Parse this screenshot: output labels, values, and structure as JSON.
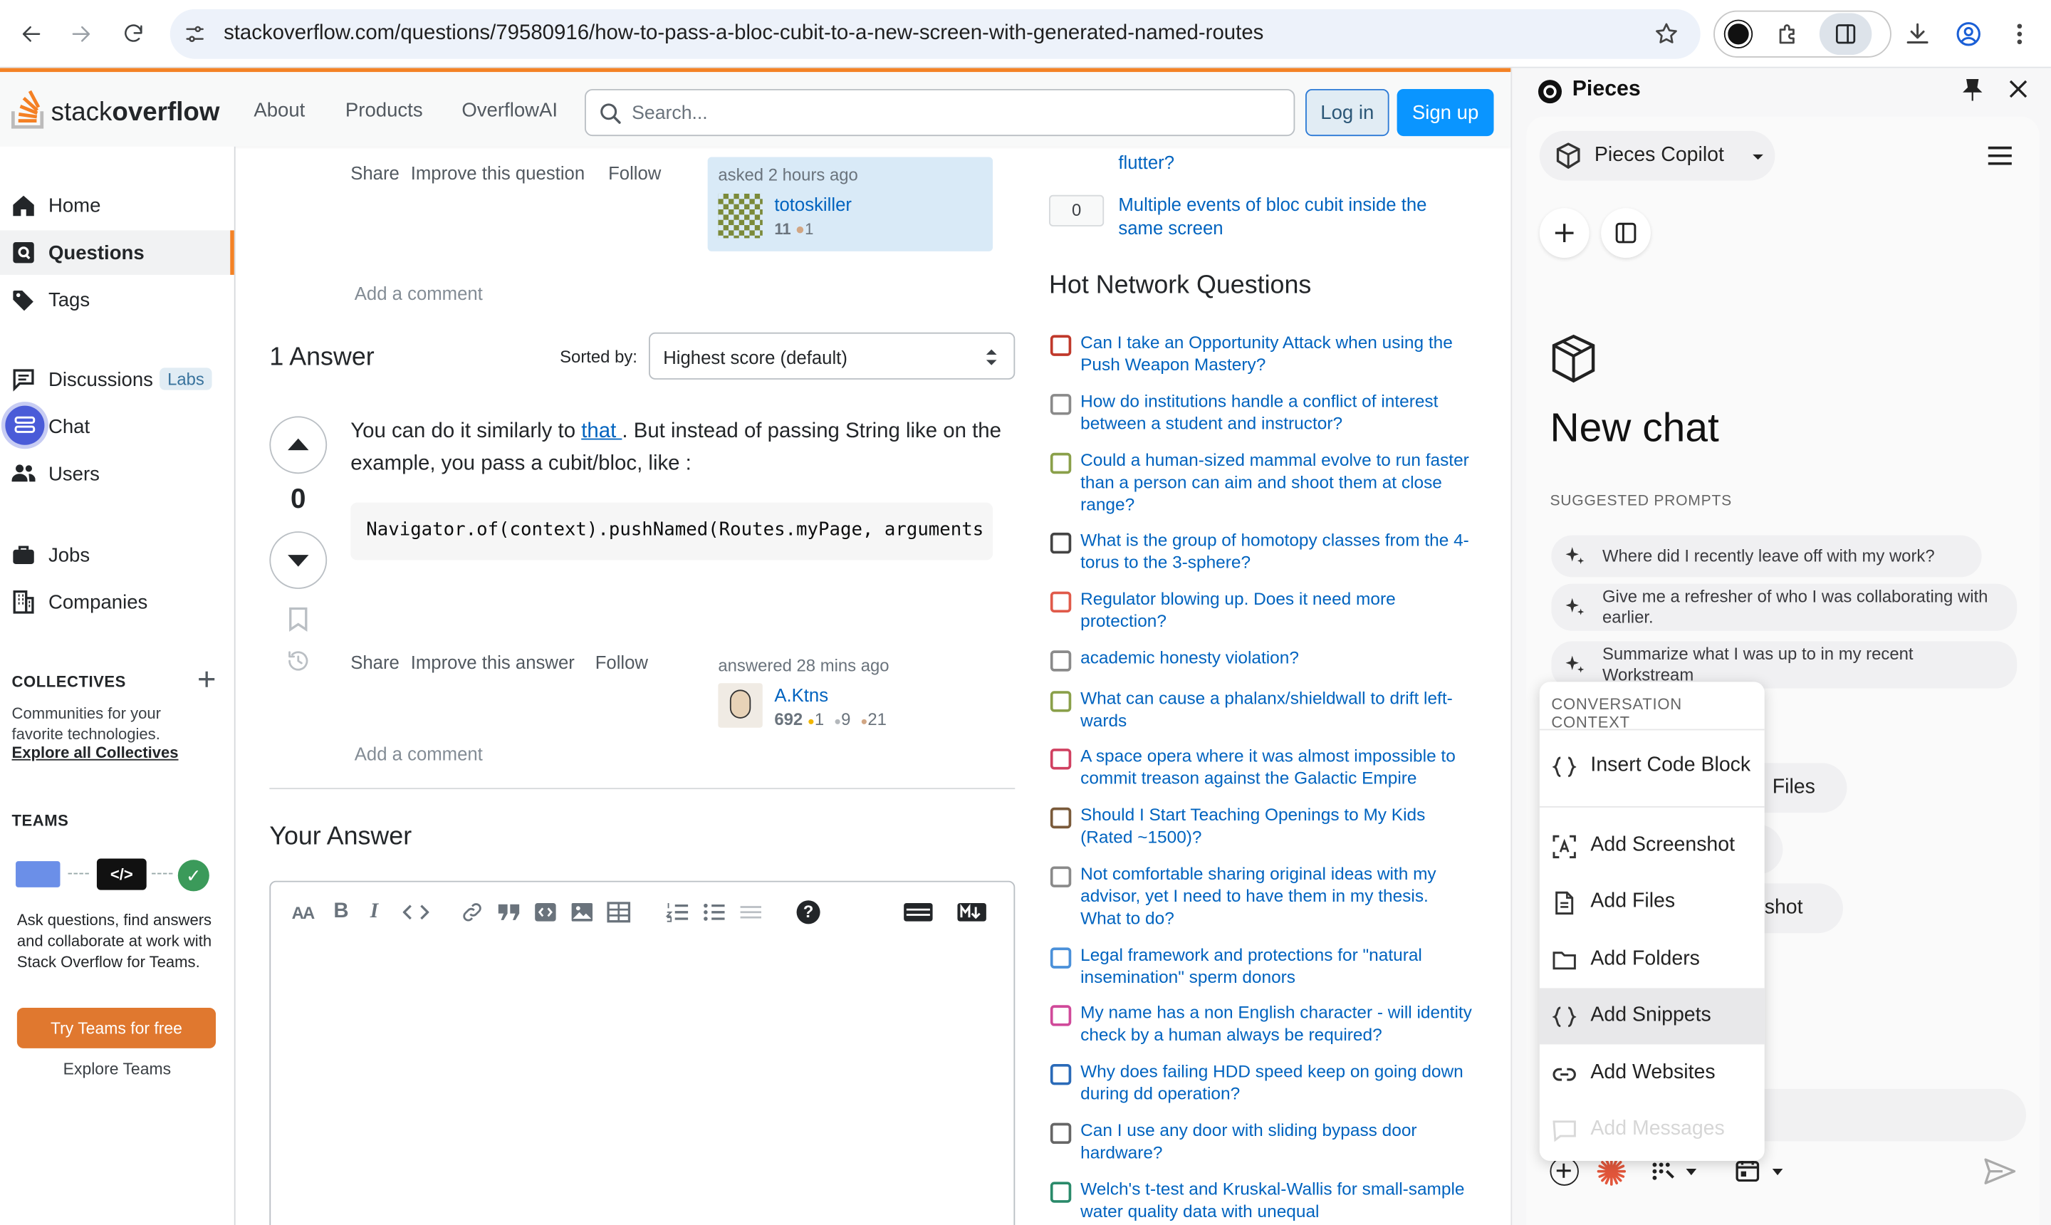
{
  "browser": {
    "url": "stackoverflow.com/questions/79580916/how-to-pass-a-bloc-cubit-to-a-new-screen-with-generated-named-routes"
  },
  "so_header": {
    "logo_text_light": "stack",
    "logo_text_bold": "overflow",
    "nav": [
      "About",
      "Products",
      "OverflowAI"
    ],
    "search_placeholder": "Search...",
    "login": "Log in",
    "signup": "Sign up"
  },
  "left_nav": {
    "items": [
      "Home",
      "Questions",
      "Tags",
      "Discussions",
      "Chat",
      "Users",
      "Jobs",
      "Companies"
    ],
    "labs_badge": "Labs",
    "collectives_title": "COLLECTIVES",
    "collectives_desc": "Communities for your favorite technologies.",
    "collectives_link": "Explore all Collectives",
    "teams_title": "TEAMS",
    "teams_desc": "Ask questions, find answers and collaborate at work with Stack Overflow for Teams.",
    "teams_button": "Try Teams for free",
    "teams_link": "Explore Teams"
  },
  "question": {
    "actions": [
      "Share",
      "Improve this question",
      "Follow"
    ],
    "asked_label": "asked 2 hours ago",
    "asker_name": "totoskiller",
    "asker_rep": "11",
    "asker_bronze": "1",
    "add_comment": "Add a comment"
  },
  "answers": {
    "count_label": "1 Answer",
    "sorted_label": "Sorted by:",
    "sort_value": "Highest score (default)",
    "vote_count": "0",
    "body_pre": "You can do it similarly to ",
    "body_link": "that ",
    "body_post": ". But instead of passing String like on the example, you pass a cubit/bloc, like :",
    "code": "Navigator.of(context).pushNamed(Routes.myPage, arguments",
    "actions": [
      "Share",
      "Improve this answer",
      "Follow"
    ],
    "answered_label": "answered 28 mins ago",
    "answerer_name": "A.Ktns",
    "answerer_rep": "692",
    "gold": "1",
    "silver": "9",
    "bronze": "21",
    "add_comment": "Add a comment",
    "your_answer": "Your Answer"
  },
  "related": {
    "partial_title": "flutter?",
    "item_score": "0",
    "item_title": "Multiple events of bloc cubit inside the same screen"
  },
  "hot_network": {
    "title": "Hot Network Questions",
    "items": [
      "Can I take an Opportunity Attack when using the Push Weapon Mastery?",
      "How do institutions handle a conflict of interest between a student and instructor?",
      "Could a human-sized mammal evolve to run faster than a person can aim and shoot them at close range?",
      "What is the group of homotopy classes from the 4-torus to the 3-sphere?",
      "Regulator blowing up. Does it need more protection?",
      "academic honesty violation?",
      "What can cause a phalanx/shieldwall to drift left-wards",
      "A space opera where it was almost impossible to commit treason against the Galactic Empire",
      "Should I Start Teaching Openings to My Kids (Rated ~1500)?",
      "Not comfortable sharing original ideas with my advisor, yet I need to have them in my thesis. What to do?",
      "Legal framework and protections for \"natural insemination\" sperm donors",
      "My name has a non English character - will identity check by a human always be required?",
      "Why does failing HDD speed keep on going down during dd operation?",
      "Can I use any door with sliding bypass door hardware?",
      "Welch's t-test and Kruskal-Wallis for small-sample water quality data with unequal"
    ],
    "icon_colors": [
      "#c0392b",
      "#8a8a8a",
      "#8aa04a",
      "#444",
      "#e05a4a",
      "#8a8a8a",
      "#8aa04a",
      "#d04060",
      "#7a5a3a",
      "#8a8a8a",
      "#4a90d9",
      "#d04a9a",
      "#2a6ab8",
      "#666",
      "#2a8a6a"
    ]
  },
  "pieces": {
    "title": "Pieces",
    "model": "Pieces Copilot",
    "new_chat": "New chat",
    "suggested_title": "SUGGESTED PROMPTS",
    "prompts": [
      "Where did I recently leave off with my work?",
      "Give me a refresher of who I was collaborating with earlier.",
      "Summarize what I was up to in my recent Workstream"
    ],
    "behind_chip_1": "Files",
    "behind_chip_2": "shot",
    "menu_title": "CONVERSATION CONTEXT",
    "menu_items": [
      "Insert Code Block",
      "Add Screenshot",
      "Add Files",
      "Add Folders",
      "Add Snippets",
      "Add Websites",
      "Add Messages"
    ]
  }
}
